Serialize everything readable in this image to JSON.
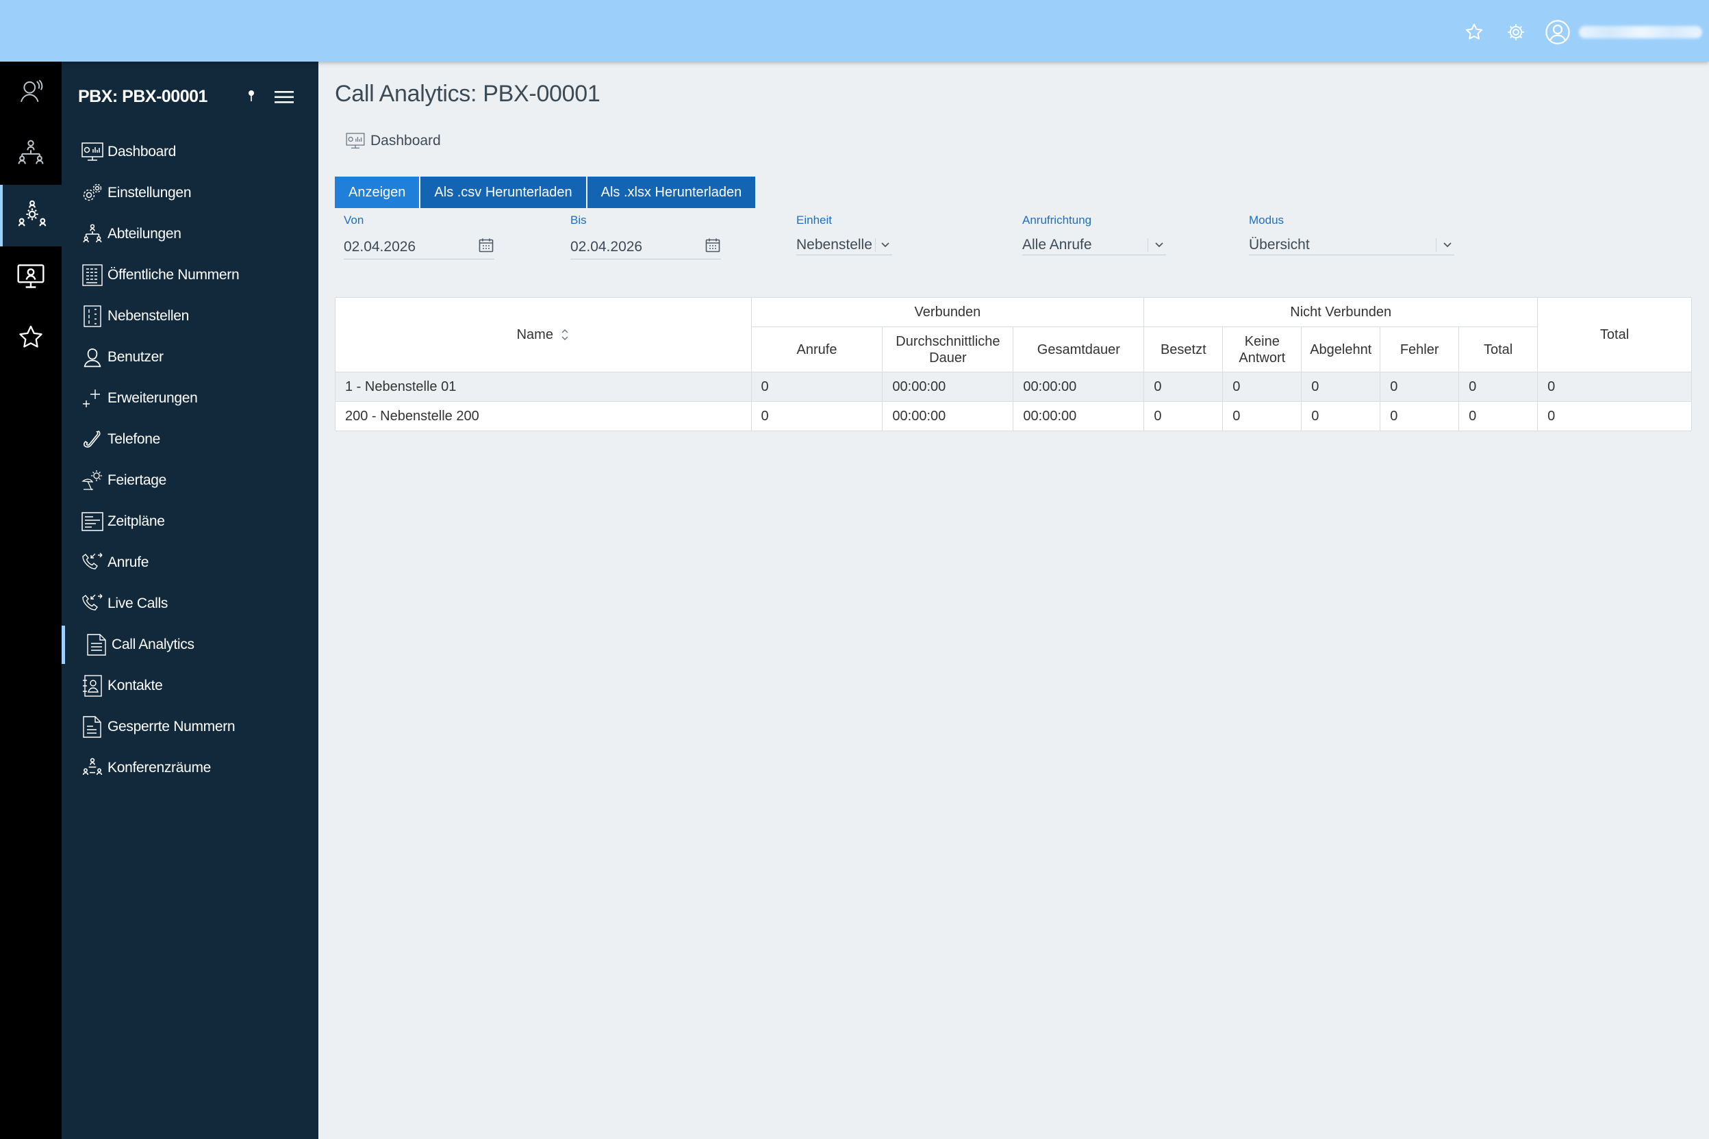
{
  "topbar": {
    "icons": [
      "star-icon",
      "gear-icon",
      "user-circle-icon"
    ],
    "username": ""
  },
  "rail": {
    "items": [
      {
        "name": "support-agent-icon"
      },
      {
        "name": "org-chart-icon"
      },
      {
        "name": "pbx-icon",
        "active": true
      },
      {
        "name": "monitor-icon"
      },
      {
        "name": "favorites-icon"
      }
    ]
  },
  "sidebar": {
    "title": "PBX: PBX-00001",
    "items": [
      {
        "label": "Dashboard",
        "icon": "dashboard-icon"
      },
      {
        "label": "Einstellungen",
        "icon": "settings-icon"
      },
      {
        "label": "Abteilungen",
        "icon": "departments-icon"
      },
      {
        "label": "Öffentliche Nummern",
        "icon": "public-numbers-icon"
      },
      {
        "label": "Nebenstellen",
        "icon": "extensions-icon"
      },
      {
        "label": "Benutzer",
        "icon": "user-icon"
      },
      {
        "label": "Erweiterungen",
        "icon": "plus-icon"
      },
      {
        "label": "Telefone",
        "icon": "phone-icon"
      },
      {
        "label": "Feiertage",
        "icon": "holiday-icon"
      },
      {
        "label": "Zeitpläne",
        "icon": "schedule-icon"
      },
      {
        "label": "Anrufe",
        "icon": "calls-icon"
      },
      {
        "label": "Live Calls",
        "icon": "live-calls-icon"
      },
      {
        "label": "Call Analytics",
        "icon": "document-icon",
        "active": true
      },
      {
        "label": "Kontakte",
        "icon": "contacts-icon"
      },
      {
        "label": "Gesperrte Nummern",
        "icon": "blocked-numbers-icon"
      },
      {
        "label": "Konferenzräume",
        "icon": "conference-icon"
      }
    ]
  },
  "main": {
    "title": "Call Analytics: PBX-00001",
    "breadcrumb": "Dashboard",
    "buttons": {
      "show": "Anzeigen",
      "csv": "Als .csv Herunterladen",
      "xlsx": "Als .xlsx Herunterladen"
    },
    "filters": {
      "from": {
        "label": "Von",
        "value": "02.04.2026"
      },
      "to": {
        "label": "Bis",
        "value": "02.04.2026"
      },
      "unit": {
        "label": "Einheit",
        "value": "Nebenstelle"
      },
      "direction": {
        "label": "Anrufrichtung",
        "value": "Alle Anrufe"
      },
      "mode": {
        "label": "Modus",
        "value": "Übersicht"
      }
    },
    "table": {
      "name_header": "Name",
      "group_connected": "Verbunden",
      "group_not_connected": "Nicht Verbunden",
      "total_header": "Total",
      "columns": [
        "Anrufe",
        "Durchschnittliche Dauer",
        "Gesamtdauer",
        "Besetzt",
        "Keine Antwort",
        "Abgelehnt",
        "Fehler",
        "Total"
      ],
      "rows": [
        [
          "1 - Nebenstelle 01",
          "0",
          "00:00:00",
          "00:00:00",
          "0",
          "0",
          "0",
          "0",
          "0",
          "0"
        ],
        [
          "200 - Nebenstelle 200",
          "0",
          "00:00:00",
          "00:00:00",
          "0",
          "0",
          "0",
          "0",
          "0",
          "0"
        ]
      ]
    }
  }
}
